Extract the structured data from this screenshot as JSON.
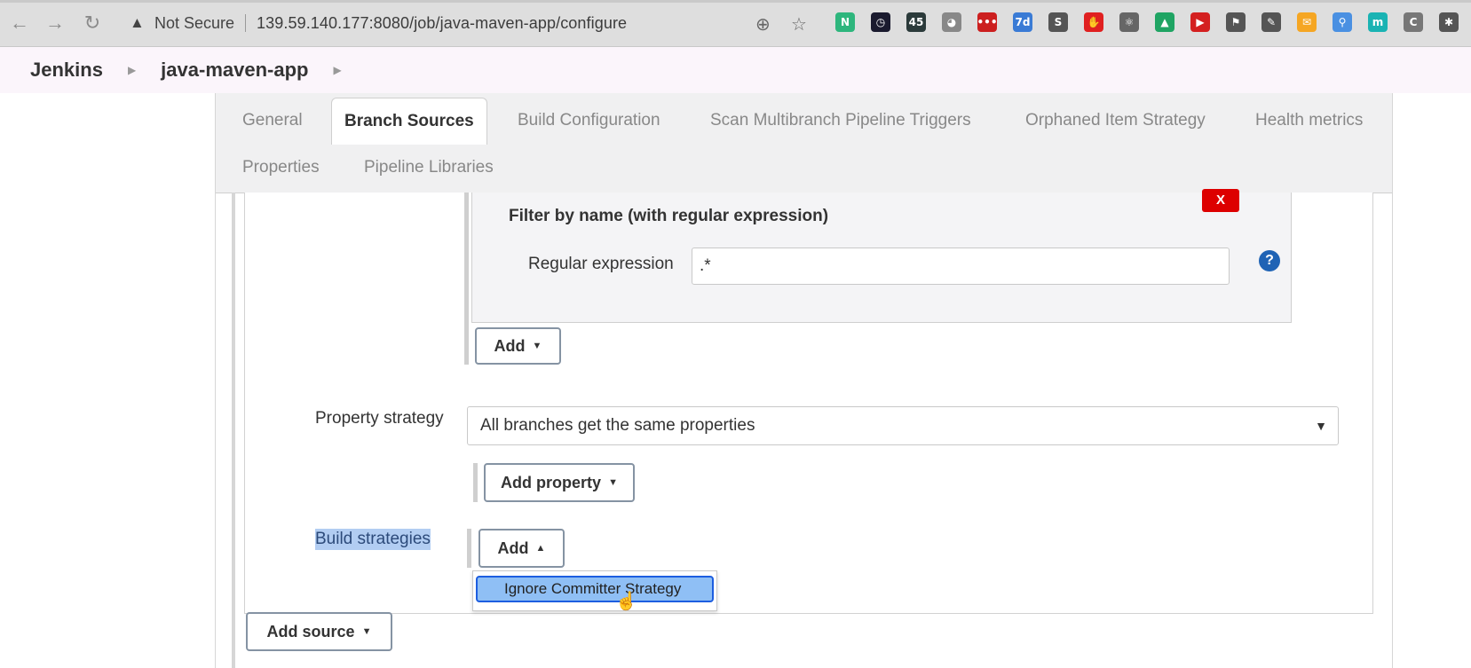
{
  "browser": {
    "security_label": "Not Secure",
    "url": "139.59.140.177:8080/job/java-maven-app/configure",
    "extensions": [
      {
        "name": "notion-ext",
        "glyph": "N",
        "color": "#2eb67d"
      },
      {
        "name": "clock-ext",
        "glyph": "◷",
        "color": "#1a1a2e"
      },
      {
        "name": "timer-ext",
        "glyph": "45",
        "color": "#2b3a3a"
      },
      {
        "name": "tomato-ext",
        "glyph": "◕",
        "color": "#888888"
      },
      {
        "name": "lastpass-ext",
        "glyph": "•••",
        "color": "#cc1f1f"
      },
      {
        "name": "calendar-ext",
        "glyph": "7d",
        "color": "#3a7bd5"
      },
      {
        "name": "s-ext",
        "glyph": "S",
        "color": "#555555"
      },
      {
        "name": "adblock-ext",
        "glyph": "✋",
        "color": "#e02020"
      },
      {
        "name": "react-ext",
        "glyph": "⚛",
        "color": "#666666"
      },
      {
        "name": "drive-ext",
        "glyph": "▲",
        "color": "#1fa463"
      },
      {
        "name": "video-ext",
        "glyph": "▶",
        "color": "#d42020"
      },
      {
        "name": "bookmark-ext",
        "glyph": "⚑",
        "color": "#555555"
      },
      {
        "name": "eyedropper-ext",
        "glyph": "✎",
        "color": "#555555"
      },
      {
        "name": "mail-ext",
        "glyph": "✉",
        "color": "#f5a623"
      },
      {
        "name": "search-ext",
        "glyph": "⚲",
        "color": "#4a90e2"
      },
      {
        "name": "m-ext",
        "glyph": "m",
        "color": "#1ab3b3"
      },
      {
        "name": "c-ext",
        "glyph": "C",
        "color": "#777777"
      },
      {
        "name": "puzzle-ext",
        "glyph": "✱",
        "color": "#555555"
      }
    ]
  },
  "breadcrumb": {
    "items": [
      "Jenkins",
      "java-maven-app"
    ]
  },
  "tabs": [
    {
      "label": "General",
      "active": false
    },
    {
      "label": "Branch Sources",
      "active": true
    },
    {
      "label": "Build Configuration",
      "active": false
    },
    {
      "label": "Scan Multibranch Pipeline Triggers",
      "active": false
    },
    {
      "label": "Orphaned Item Strategy",
      "active": false
    },
    {
      "label": "Health metrics",
      "active": false
    },
    {
      "label": "Properties",
      "active": false
    },
    {
      "label": "Pipeline Libraries",
      "active": false
    }
  ],
  "filter": {
    "title": "Filter by name (with regular expression)",
    "delete_label": "X",
    "regex_label": "Regular expression",
    "regex_value": ".*",
    "help_label": "?",
    "add_label": "Add"
  },
  "property_strategy": {
    "label": "Property strategy",
    "selected": "All branches get the same properties",
    "add_property_label": "Add property"
  },
  "build_strategies": {
    "label": "Build strategies",
    "add_label": "Add",
    "menu_items": [
      "Ignore Committer Strategy"
    ]
  },
  "add_source_label": "Add source"
}
